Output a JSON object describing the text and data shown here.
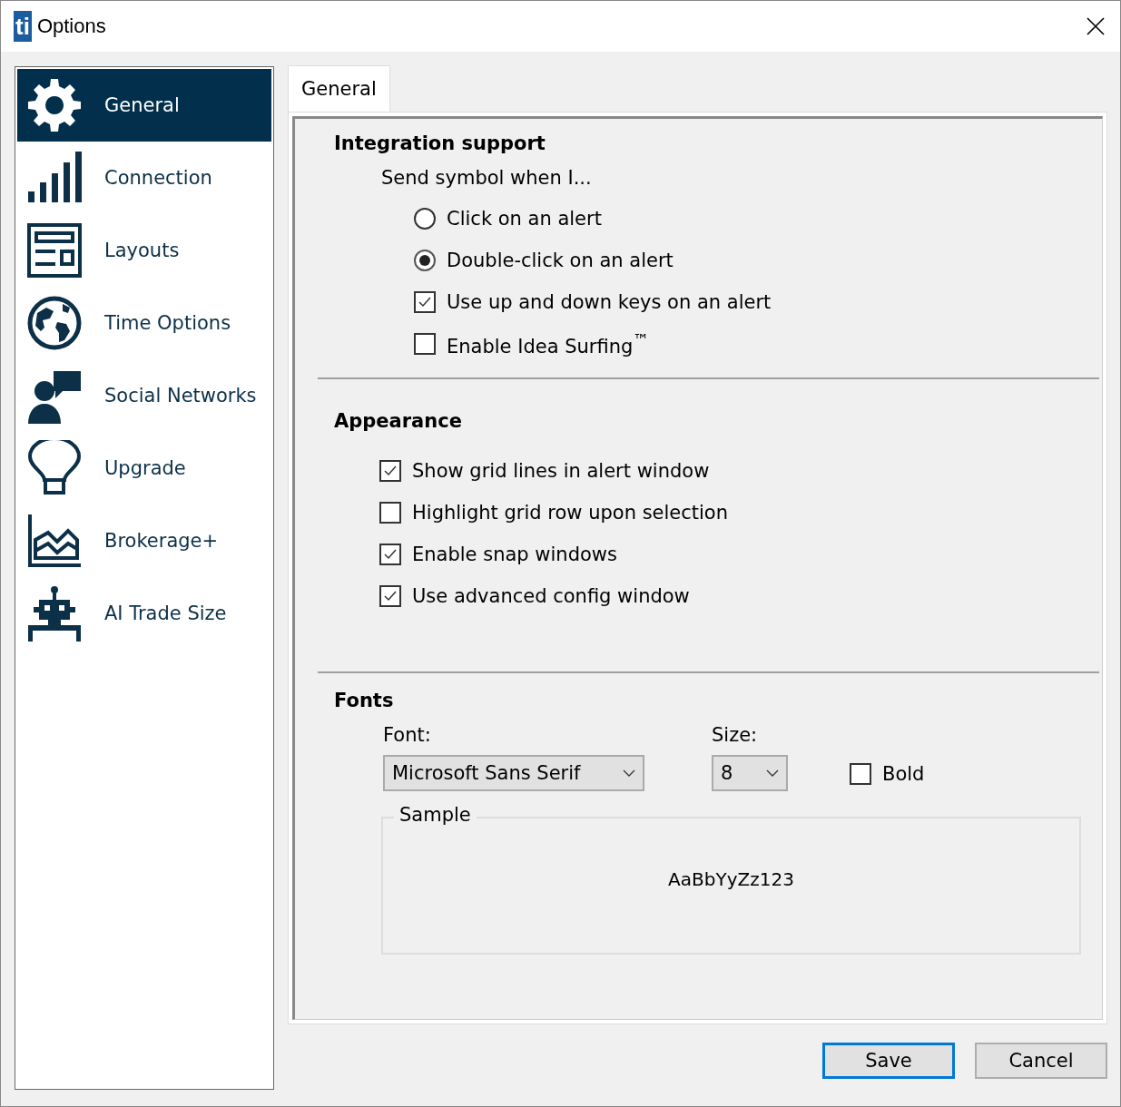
{
  "window": {
    "logo": "ti",
    "title": "Options"
  },
  "sidebar": {
    "items": [
      {
        "label": "General",
        "kind": "gear",
        "selected": true
      },
      {
        "label": "Connection",
        "kind": "signal",
        "selected": false
      },
      {
        "label": "Layouts",
        "kind": "layout",
        "selected": false
      },
      {
        "label": "Time Options",
        "kind": "globe",
        "selected": false
      },
      {
        "label": "Social Networks",
        "kind": "social",
        "selected": false
      },
      {
        "label": "Upgrade",
        "kind": "bulb",
        "selected": false
      },
      {
        "label": "Brokerage+",
        "kind": "chart",
        "selected": false
      },
      {
        "label": "AI Trade Size",
        "kind": "robot",
        "selected": false
      }
    ]
  },
  "tabs": [
    {
      "label": "General",
      "selected": true
    }
  ],
  "integration": {
    "heading": "Integration support",
    "prompt": "Send symbol when I...",
    "options": [
      {
        "kind": "radio",
        "label": "Click on an alert",
        "checked": false
      },
      {
        "kind": "radio",
        "label": "Double-click on an alert",
        "checked": true
      },
      {
        "kind": "checkbox",
        "label": "Use up and down keys on an alert",
        "checked": true
      },
      {
        "kind": "checkbox",
        "label": "Enable Idea Surfing$^{™}$",
        "checked": false
      }
    ]
  },
  "appearance": {
    "heading": "Appearance",
    "options": [
      {
        "label": "Show grid lines in alert window",
        "checked": true
      },
      {
        "label": "Highlight grid row upon selection",
        "checked": false
      },
      {
        "label": "Enable snap windows",
        "checked": true
      },
      {
        "label": "Use advanced config window",
        "checked": true
      }
    ]
  },
  "fonts": {
    "heading": "Fonts",
    "font_label": "Font:",
    "font_value": "Microsoft Sans Serif",
    "size_label": "Size:",
    "size_value": "8",
    "bold": {
      "label": "Bold",
      "checked": false
    },
    "sample_label": "Sample",
    "sample_text": "AaBbYyZz123"
  },
  "buttons": [
    {
      "label": "Save",
      "default": true
    },
    {
      "label": "Cancel",
      "default": false
    }
  ]
}
